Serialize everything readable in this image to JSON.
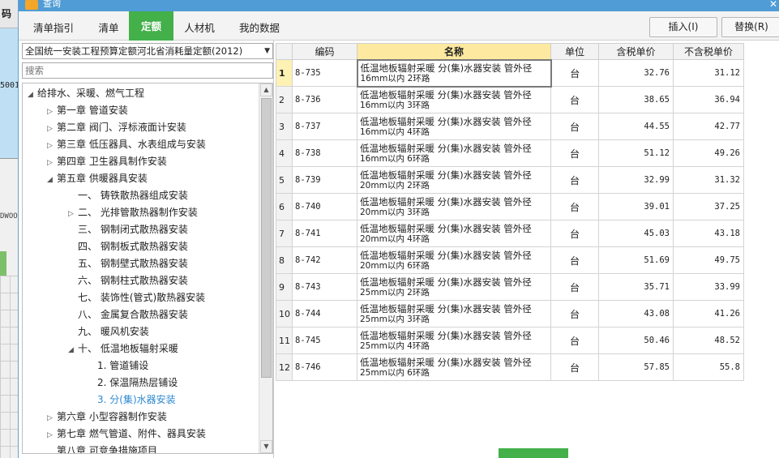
{
  "background_app": {
    "header_text": "码",
    "cell_number": "5001",
    "cell_code": "DWOO"
  },
  "window": {
    "title": "查询"
  },
  "tabs": [
    "清单指引",
    "清单",
    "定额",
    "人材机",
    "我的数据"
  ],
  "active_tab": "定额",
  "toolbar": {
    "insert_label": "插入(I)",
    "replace_label": "替换(R)"
  },
  "left": {
    "quota_library": "全国统一安装工程预算定额河北省消耗量定额(2012)",
    "search_placeholder": "搜索",
    "tree": [
      {
        "label": "给排水、采暖、燃气工程",
        "arrow": "◢"
      },
      {
        "label": "第一章 管道安装",
        "arrow": "▷"
      },
      {
        "label": "第二章 阀门、浮标液面计安装",
        "arrow": "▷"
      },
      {
        "label": "第三章 低压器具、水表组成与安装",
        "arrow": "▷"
      },
      {
        "label": "第四章 卫生器具制作安装",
        "arrow": "▷"
      },
      {
        "label": "第五章 供暖器具安装",
        "arrow": "◢"
      },
      {
        "label": "一、 铸铁散热器组成安装",
        "arrow": ""
      },
      {
        "label": "二、 光排管散热器制作安装",
        "arrow": "▷"
      },
      {
        "label": "三、 钢制闭式散热器安装",
        "arrow": ""
      },
      {
        "label": "四、 钢制板式散热器安装",
        "arrow": ""
      },
      {
        "label": "五、 钢制壁式散热器安装",
        "arrow": ""
      },
      {
        "label": "六、 钢制柱式散热器安装",
        "arrow": ""
      },
      {
        "label": "七、 装饰性(管式)散热器安装",
        "arrow": ""
      },
      {
        "label": "八、 金属复合散热器安装",
        "arrow": ""
      },
      {
        "label": "九、 暖风机安装",
        "arrow": ""
      },
      {
        "label": "十、 低温地板辐射采暖",
        "arrow": "◢"
      },
      {
        "label": "1. 管道铺设",
        "arrow": ""
      },
      {
        "label": "2. 保温隔热层铺设",
        "arrow": ""
      },
      {
        "label": "3. 分(集)水器安装",
        "arrow": ""
      },
      {
        "label": "第六章 小型容器制作安装",
        "arrow": "▷"
      },
      {
        "label": "第七章 燃气管道、附件、器具安装",
        "arrow": "▷"
      },
      {
        "label": "第八章 可竞争措施项目",
        "arrow": ""
      }
    ]
  },
  "table": {
    "headers": {
      "code": "编码",
      "name": "名称",
      "unit": "单位",
      "price_tax": "含税单价",
      "price_notax": "不含税单价"
    },
    "rows": [
      {
        "no": "1",
        "code": "8-735",
        "name1": "低温地板辐射采暖 分(集)水器安装 管外径",
        "name2": "16mm以内 2环路",
        "unit": "台",
        "price_tax": "32.76",
        "price_notax": "31.12"
      },
      {
        "no": "2",
        "code": "8-736",
        "name1": "低温地板辐射采暖 分(集)水器安装 管外径",
        "name2": "16mm以内 3环路",
        "unit": "台",
        "price_tax": "38.65",
        "price_notax": "36.94"
      },
      {
        "no": "3",
        "code": "8-737",
        "name1": "低温地板辐射采暖 分(集)水器安装 管外径",
        "name2": "16mm以内 4环路",
        "unit": "台",
        "price_tax": "44.55",
        "price_notax": "42.77"
      },
      {
        "no": "4",
        "code": "8-738",
        "name1": "低温地板辐射采暖 分(集)水器安装 管外径",
        "name2": "16mm以内 6环路",
        "unit": "台",
        "price_tax": "51.12",
        "price_notax": "49.26"
      },
      {
        "no": "5",
        "code": "8-739",
        "name1": "低温地板辐射采暖 分(集)水器安装 管外径",
        "name2": "20mm以内 2环路",
        "unit": "台",
        "price_tax": "32.99",
        "price_notax": "31.32"
      },
      {
        "no": "6",
        "code": "8-740",
        "name1": "低温地板辐射采暖 分(集)水器安装 管外径",
        "name2": "20mm以内 3环路",
        "unit": "台",
        "price_tax": "39.01",
        "price_notax": "37.25"
      },
      {
        "no": "7",
        "code": "8-741",
        "name1": "低温地板辐射采暖 分(集)水器安装 管外径",
        "name2": "20mm以内 4环路",
        "unit": "台",
        "price_tax": "45.03",
        "price_notax": "43.18"
      },
      {
        "no": "8",
        "code": "8-742",
        "name1": "低温地板辐射采暖 分(集)水器安装 管外径",
        "name2": "20mm以内 6环路",
        "unit": "台",
        "price_tax": "51.69",
        "price_notax": "49.75"
      },
      {
        "no": "9",
        "code": "8-743",
        "name1": "低温地板辐射采暖 分(集)水器安装 管外径",
        "name2": "25mm以内 2环路",
        "unit": "台",
        "price_tax": "35.71",
        "price_notax": "33.99"
      },
      {
        "no": "10",
        "code": "8-744",
        "name1": "低温地板辐射采暖 分(集)水器安装 管外径",
        "name2": "25mm以内 3环路",
        "unit": "台",
        "price_tax": "43.08",
        "price_notax": "41.26"
      },
      {
        "no": "11",
        "code": "8-745",
        "name1": "低温地板辐射采暖 分(集)水器安装 管外径",
        "name2": "25mm以内 4环路",
        "unit": "台",
        "price_tax": "50.46",
        "price_notax": "48.52"
      },
      {
        "no": "12",
        "code": "8-746",
        "name1": "低温地板辐射采暖 分(集)水器安装 管外径",
        "name2": "25mm以内 6环路",
        "unit": "台",
        "price_tax": "57.85",
        "price_notax": "55.8"
      }
    ]
  }
}
